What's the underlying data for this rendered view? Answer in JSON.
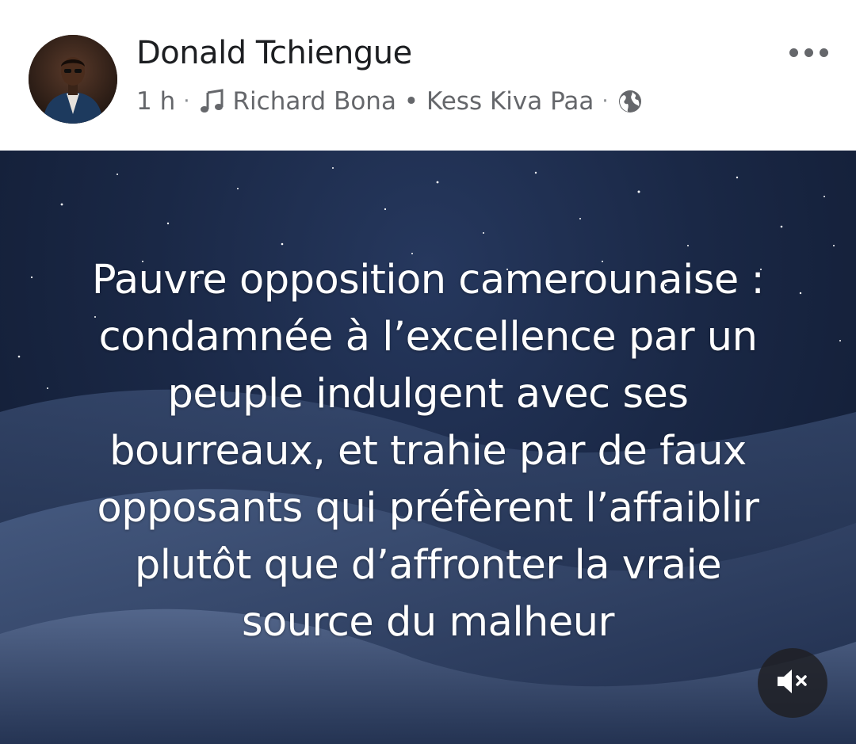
{
  "post": {
    "author": "Donald Tchiengue",
    "time": "1 h",
    "separator": "·",
    "song": "Richard Bona • Kess Kiva Paa",
    "audience_icon": "globe-icon",
    "music_icon": "music-note-icon",
    "more_icon": "more-options-icon"
  },
  "media": {
    "text": "Pauvre opposition camerounaise : condamnée à l’excellence par un peuple indulgent avec ses bourreaux, et trahie par de faux opposants qui préfèrent l’affaiblir plutôt que d’affronter la vraie source du malheur",
    "lines": [
      "Pauvre opposition camerounaise :",
      "condamnée à l’excellence par un",
      "peuple indulgent avec ses",
      "bourreaux, et trahie par de faux",
      "opposants qui préfèrent l’affaiblir",
      "plutôt que d’affronter la vraie",
      "source du malheur"
    ],
    "mute_icon": "speaker-muted-icon"
  },
  "colors": {
    "name": "#1c1e21",
    "meta": "#65676b",
    "sky": "#1a2846"
  }
}
